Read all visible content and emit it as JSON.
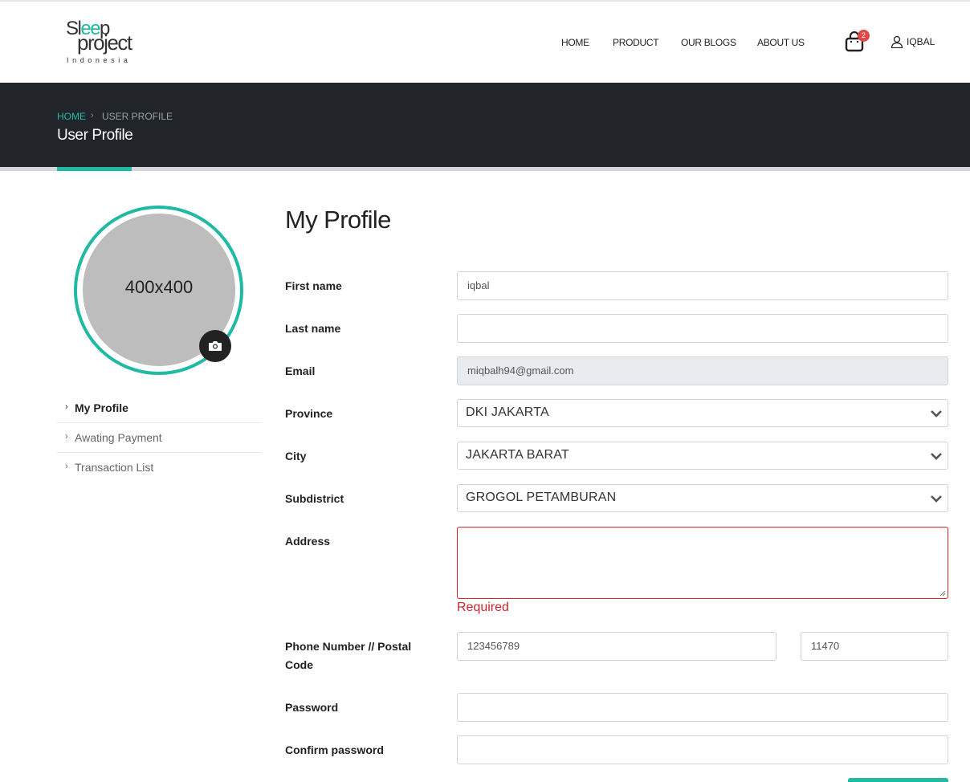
{
  "logo": {
    "line1": "Sleep",
    "line2": "project",
    "line3": "Indonesia"
  },
  "nav": {
    "home": "HOME",
    "product": "PRODUCT",
    "blogs": "OUR BLOGS",
    "about": "ABOUT US"
  },
  "cart": {
    "count": "2",
    "icon": "shopping-bag-icon"
  },
  "user": {
    "name": "IQBAL",
    "icon": "user-icon"
  },
  "breadcrumb": {
    "home": "HOME",
    "separator": "›",
    "current": "USER PROFILE"
  },
  "banner": {
    "title": "User Profile"
  },
  "avatar": {
    "placeholder": "400x400",
    "camera_icon": "camera-icon"
  },
  "sidebar": {
    "items": [
      {
        "label": "My Profile",
        "active": true
      },
      {
        "label": "Awating Payment",
        "active": false
      },
      {
        "label": "Transaction List",
        "active": false
      }
    ]
  },
  "form": {
    "title": "My Profile",
    "first_name": {
      "label": "First name",
      "value": "iqbal"
    },
    "last_name": {
      "label": "Last name",
      "value": ""
    },
    "email": {
      "label": "Email",
      "value": "miqbalh94@gmail.com"
    },
    "province": {
      "label": "Province",
      "value": "DKI JAKARTA"
    },
    "city": {
      "label": "City",
      "value": "JAKARTA BARAT"
    },
    "subdistrict": {
      "label": "Subdistrict",
      "value": "GROGOL PETAMBURAN"
    },
    "address": {
      "label": "Address",
      "value": "",
      "error": "Required"
    },
    "phone_postal": {
      "label_line1": "Phone Number // Postal",
      "label_line2": "Code",
      "phone": "123456789",
      "postal": "11470"
    },
    "password": {
      "label": "Password",
      "value": ""
    },
    "confirm_password": {
      "label": "Confirm password",
      "value": ""
    }
  },
  "colors": {
    "accent": "#20b9a4",
    "banner": "#212529",
    "error": "#d0242b",
    "badge": "#e04848"
  }
}
